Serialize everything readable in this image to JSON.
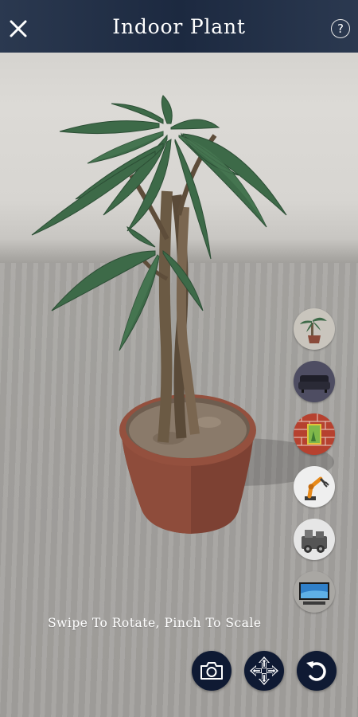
{
  "header": {
    "title": "Indoor Plant",
    "close_icon": "close-icon",
    "help_label": "?"
  },
  "hint": "Swipe To Rotate, Pinch To Scale",
  "catalog": {
    "items": [
      {
        "name": "plant-thumbnail",
        "icon": "potted-plant"
      },
      {
        "name": "sofa-thumbnail",
        "icon": "sofa"
      },
      {
        "name": "wall-frame-thumbnail",
        "icon": "picture-frame-on-brick-wall"
      },
      {
        "name": "robot-arm-thumbnail",
        "icon": "robotic-arm"
      },
      {
        "name": "machine-thumbnail",
        "icon": "engine-machine"
      },
      {
        "name": "tv-thumbnail",
        "icon": "television"
      }
    ]
  },
  "controls": {
    "camera_icon": "camera-icon",
    "move_icon": "move-arrows-icon",
    "undo_icon": "undo-icon",
    "color": "#0f1a33"
  },
  "colors": {
    "topbar": "#1c2940",
    "leaf": "#3f6b49",
    "pot": "#8a4a39"
  }
}
